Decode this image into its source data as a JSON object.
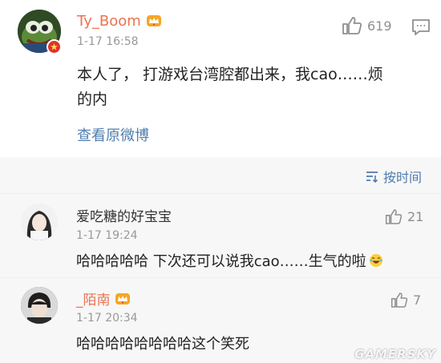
{
  "main_post": {
    "username": "Ty_Boom",
    "timestamp": "1-17 16:58",
    "like_count": "619",
    "body_line1": "本人了， 打游戏台湾腔都出来，我cao……烦",
    "body_line2": "的内",
    "view_original": "查看原微博"
  },
  "sort": {
    "label": "按时间",
    "icon": "sort-icon"
  },
  "comments": [
    {
      "username": "爱吃糖的好宝宝",
      "timestamp": "1-17 19:24",
      "like_count": "21",
      "text": "哈哈哈哈哈 下次还可以说我cao……生气的啦"
    },
    {
      "username": "_陌南",
      "timestamp": "1-17 20:34",
      "like_count": "7",
      "text": "哈哈哈哈哈哈哈哈这个笑死"
    }
  ],
  "watermark": "GAMERSKY",
  "colors": {
    "username_orange": "#eb7350",
    "link_blue": "#507daf",
    "meta_grey": "#999999",
    "grey_background": "#f7f7f7"
  }
}
